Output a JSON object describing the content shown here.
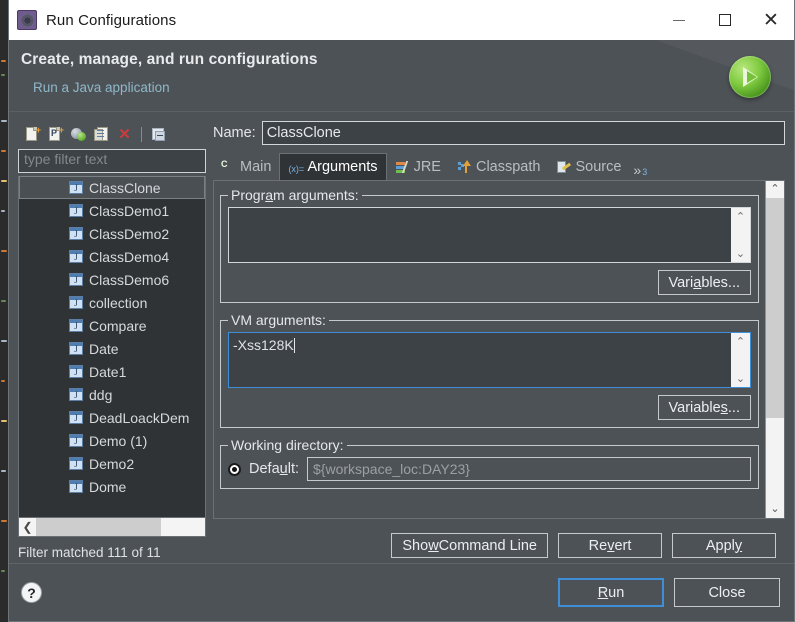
{
  "window": {
    "title": "Run Configurations",
    "icon": "gear-icon",
    "minimize": "—",
    "maximize": "□",
    "close": "✕"
  },
  "header": {
    "title": "Create, manage, and run configurations",
    "subtitle": "Run a Java application",
    "badge_icon": "run-play-icon"
  },
  "left_pane": {
    "toolbar": [
      {
        "name": "new-configuration-icon",
        "title": "New launch configuration"
      },
      {
        "name": "new-prototype-icon",
        "title": "New prototype"
      },
      {
        "name": "export-configuration-icon",
        "title": "Export"
      },
      {
        "name": "duplicate-configuration-icon",
        "title": "Duplicate"
      },
      {
        "name": "delete-configuration-icon",
        "title": "Delete"
      },
      {
        "name": "collapse-all-icon",
        "title": "Collapse All"
      }
    ],
    "filter": {
      "placeholder": "type filter text",
      "value": ""
    },
    "tree_items": [
      {
        "label": "ClassClone",
        "selected": true
      },
      {
        "label": "ClassDemo1",
        "selected": false
      },
      {
        "label": "ClassDemo2",
        "selected": false
      },
      {
        "label": "ClassDemo4",
        "selected": false
      },
      {
        "label": "ClassDemo6",
        "selected": false
      },
      {
        "label": "collection",
        "selected": false
      },
      {
        "label": "Compare",
        "selected": false
      },
      {
        "label": "Date",
        "selected": false
      },
      {
        "label": "Date1",
        "selected": false
      },
      {
        "label": "ddg",
        "selected": false
      },
      {
        "label": "DeadLoackDem",
        "selected": false
      },
      {
        "label": "Demo (1)",
        "selected": false
      },
      {
        "label": "Demo2",
        "selected": false
      },
      {
        "label": "Dome",
        "selected": false
      }
    ],
    "status": "Filter matched 111 of 11"
  },
  "right_pane": {
    "name_label": "Name:",
    "name_value": "ClassClone",
    "tabs": [
      {
        "label": "Main",
        "icon": "main-class-icon",
        "active": false
      },
      {
        "label": "Arguments",
        "icon": "arguments-icon",
        "active": true
      },
      {
        "label": "JRE",
        "icon": "jre-icon",
        "active": false
      },
      {
        "label": "Classpath",
        "icon": "classpath-icon",
        "active": false
      },
      {
        "label": "Source",
        "icon": "source-icon",
        "active": false
      }
    ],
    "tab_overflow": {
      "symbol": "»",
      "count": "3"
    },
    "program_arguments": {
      "legend_pre": "Progr",
      "legend_mnemonic": "a",
      "legend_post": "m arguments:",
      "legend_full": "Program arguments:",
      "value": "",
      "variables_button": {
        "pre": "Vari",
        "mnemonic": "a",
        "post": "bles..."
      }
    },
    "vm_arguments": {
      "legend_pre": "VM ar",
      "legend_mnemonic": "g",
      "legend_post": "uments:",
      "legend_full": "VM arguments:",
      "value": "-Xss128K",
      "focused": true,
      "variables_button": {
        "pre": "Variable",
        "mnemonic": "s",
        "post": "..."
      }
    },
    "working_directory": {
      "legend": "Working directory:",
      "default_pre": "Defa",
      "default_mnemonic": "u",
      "default_post": "lt:",
      "default_selected": true,
      "path_value": "${workspace_loc:DAY23}"
    },
    "scrollbar": {
      "up": "⌃",
      "down": "⌄"
    }
  },
  "action_buttons": {
    "show_command_line": {
      "pre": "Sho",
      "mnemonic": "w",
      "post": " Command Line"
    },
    "revert": {
      "pre": "Re",
      "mnemonic": "v",
      "post": "ert"
    },
    "apply": {
      "pre": "Appl",
      "mnemonic": "y",
      "post": ""
    }
  },
  "footer": {
    "help_icon": "help-question-icon",
    "run": {
      "pre": "",
      "mnemonic": "R",
      "post": "un"
    },
    "close": {
      "pre": "Close",
      "mnemonic": "",
      "post": ""
    }
  },
  "colors": {
    "dialog_bg": "#4d5256",
    "tree_bg": "#2f3335",
    "field_bg": "#3d4246",
    "accent_focus": "#3f8fd8",
    "link_text": "#8fb7c9",
    "delete_red": "#cf3b3b",
    "run_green": "#7ec93f"
  }
}
